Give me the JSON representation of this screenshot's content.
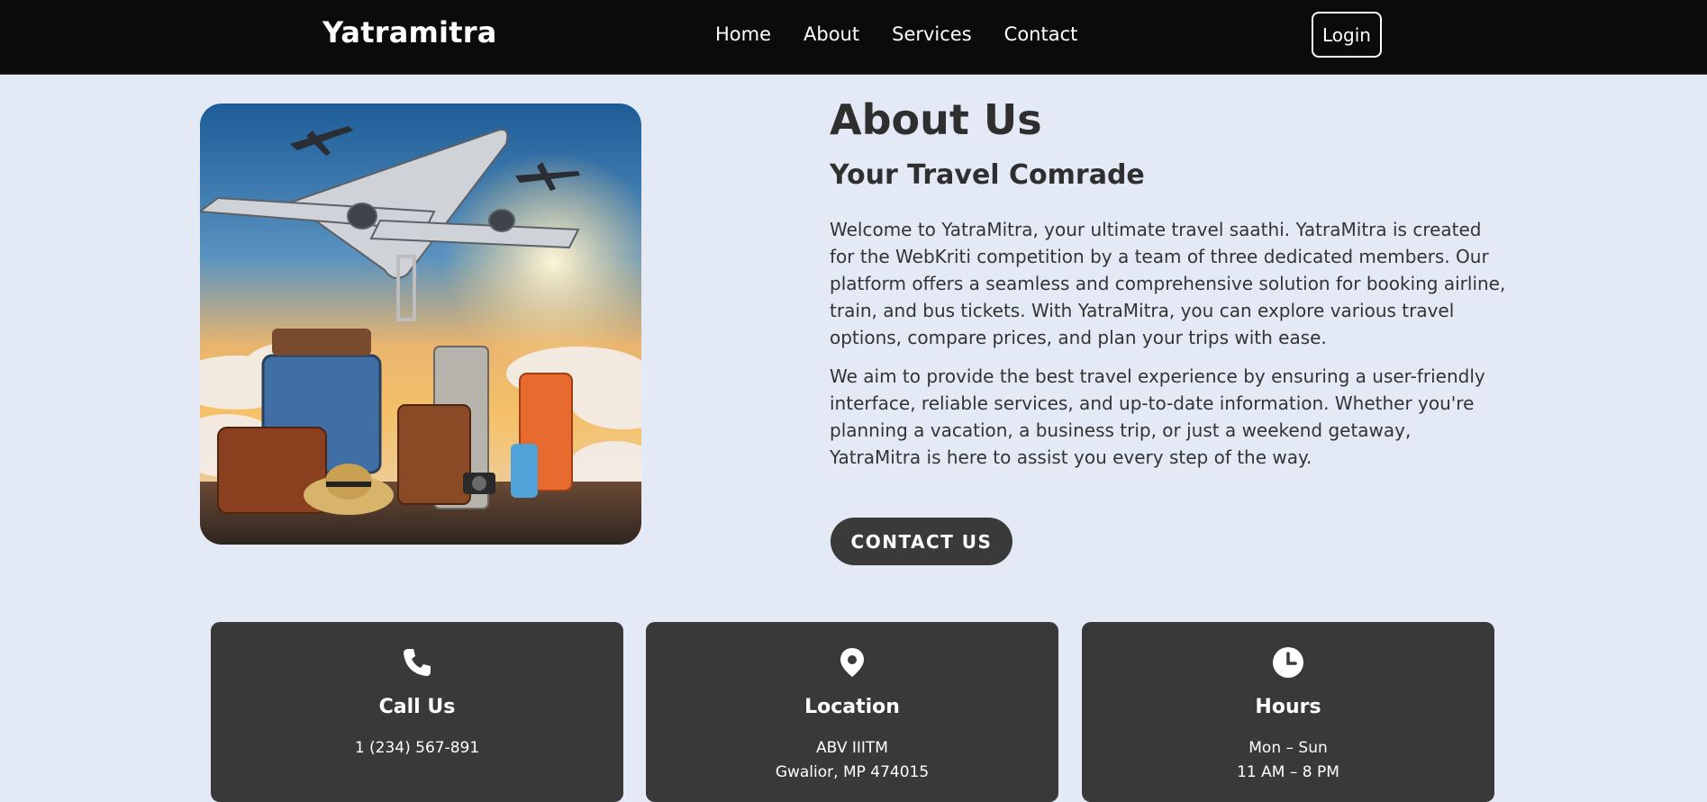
{
  "header": {
    "brand": "Yatramitra",
    "nav": [
      {
        "label": "Home"
      },
      {
        "label": "About"
      },
      {
        "label": "Services"
      },
      {
        "label": "Contact"
      }
    ],
    "login_label": "Login"
  },
  "about": {
    "title": "About Us",
    "subtitle": "Your Travel Comrade",
    "paragraph1": "Welcome to YatraMitra, your ultimate travel saathi. YatraMitra is created for the WebKriti competition by a team of three dedicated members. Our platform offers a seamless and comprehensive solution for booking airline, train, and bus tickets. With YatraMitra, you can explore various travel options, compare prices, and plan your trips with ease.",
    "paragraph2": "We aim to provide the best travel experience by ensuring a user-friendly interface, reliable services, and up-to-date information. Whether you're planning a vacation, a business trip, or just a weekend getaway, YatraMitra is here to assist you every step of the way.",
    "contact_button": "CONTACT US",
    "image_icon": "airplanes-and-luggage-illustration"
  },
  "cards": [
    {
      "icon": "phone-icon",
      "title": "Call Us",
      "line1": "1 (234) 567-891",
      "line2": ""
    },
    {
      "icon": "location-pin-icon",
      "title": "Location",
      "line1": "ABV IIITM",
      "line2": "Gwalior, MP 474015"
    },
    {
      "icon": "clock-icon",
      "title": "Hours",
      "line1": "Mon – Sun",
      "line2": "11 AM – 8 PM"
    }
  ],
  "colors": {
    "page_bg": "#e4e9f6",
    "header_bg": "#0b0b0b",
    "card_bg": "#393939",
    "button_bg": "#3a3a3a",
    "text_dark": "#2f2f2f"
  }
}
